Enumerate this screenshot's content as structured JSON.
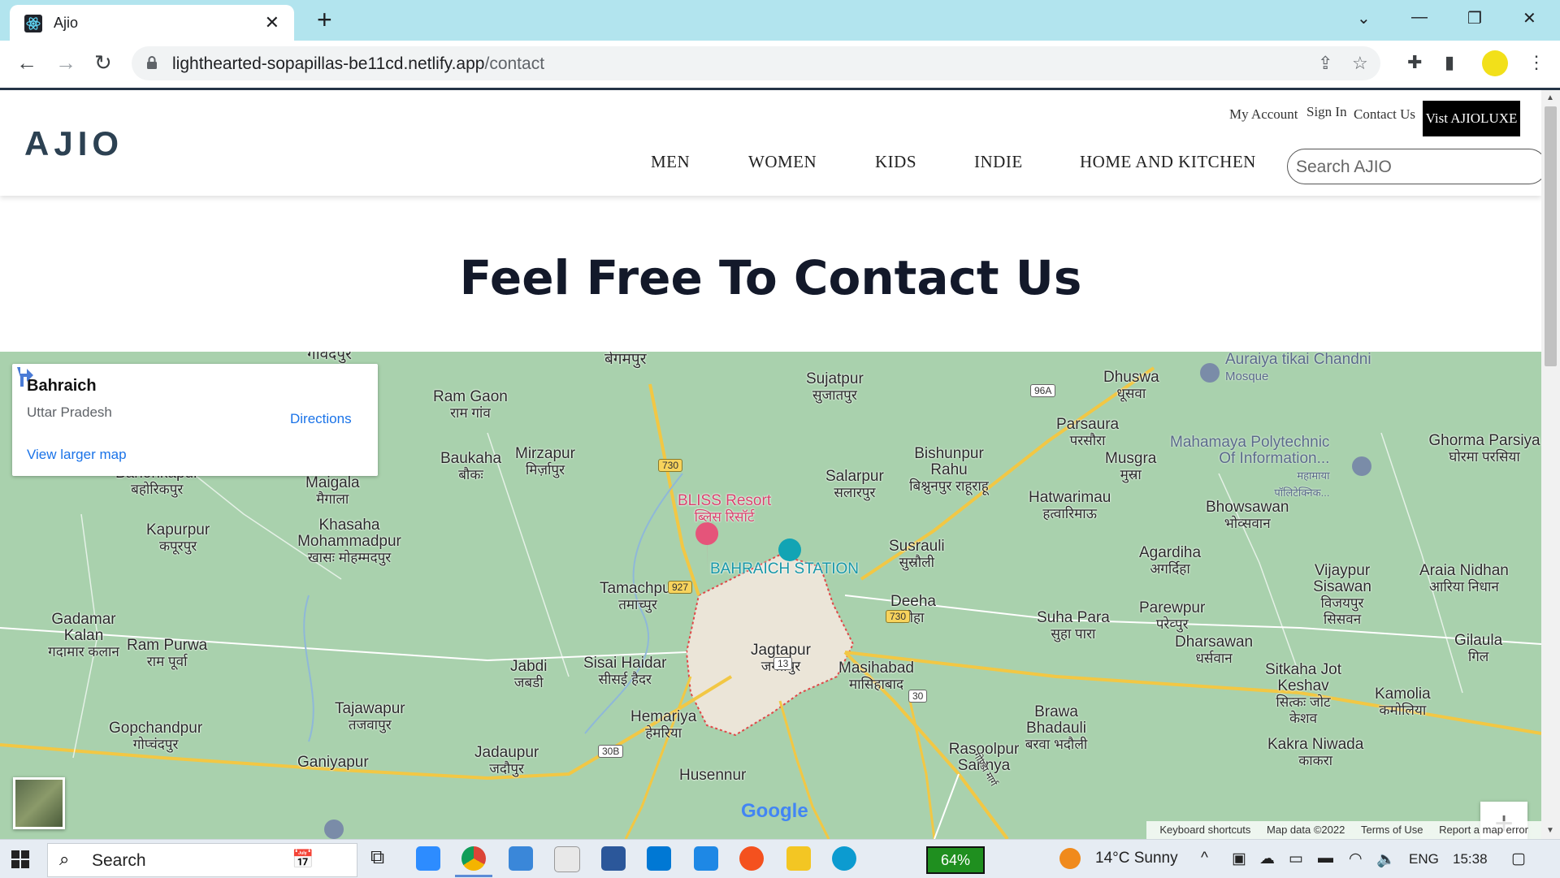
{
  "browser": {
    "tab_title": "Ajio",
    "url_host": "lighthearted-sopapillas-be11cd.netlify.app",
    "url_path": "/contact"
  },
  "site": {
    "logo": "AJIO",
    "top_links": [
      "My Account",
      "Sign In",
      "Contact Us"
    ],
    "luxe_button": "Vist AJIOLUXE",
    "nav": [
      "MEN",
      "WOMEN",
      "KIDS",
      "INDIE",
      "HOME AND KITCHEN"
    ],
    "search_placeholder": "Search AJIO"
  },
  "page": {
    "heading": "Feel Free To Contact Us"
  },
  "map": {
    "info": {
      "title": "Bahraich",
      "subtitle": "Uttar Pradesh",
      "link": "View larger map",
      "directions": "Directions"
    },
    "places": [
      {
        "name": "गांवदपुर",
        "alt": ""
      },
      {
        "name": "बेगमपुर",
        "alt": ""
      },
      {
        "name": "Sujatpur",
        "alt": "सुजातपुर"
      },
      {
        "name": "Ram Gaon",
        "alt": "राम गांव"
      },
      {
        "name": "Dhuswa",
        "alt": "धूसवा"
      },
      {
        "name": "Parsaura",
        "alt": "परसौरा"
      },
      {
        "name": "Musgra",
        "alt": "मुस्रा"
      },
      {
        "name": "Ghorma Parsiya",
        "alt": "घोरमा परसिया"
      },
      {
        "name": "Baukaha",
        "alt": "बौकः"
      },
      {
        "name": "Mirzapur",
        "alt": "मिर्ज़ापुर"
      },
      {
        "name": "Bahorikapur",
        "alt": "बहोरिकपुर"
      },
      {
        "name": "Maigala",
        "alt": "मैगाला"
      },
      {
        "name": "Bishunpur Rahu",
        "alt": "बिश्नुनपुर राहूराहू"
      },
      {
        "name": "Salarpur",
        "alt": "सलारपुर"
      },
      {
        "name": "Hatwarimau",
        "alt": "हत्वारिमाऊ"
      },
      {
        "name": "Bhowsawan",
        "alt": "भोव्सवान"
      },
      {
        "name": "Kapurpur",
        "alt": "कपूरपुर"
      },
      {
        "name": "Khasaha Mohammadpur",
        "alt": "खासः मोहम्मदपुर"
      },
      {
        "name": "Susrauli",
        "alt": "सुस्रौली"
      },
      {
        "name": "Agardiha",
        "alt": "अगर्दिहा"
      },
      {
        "name": "Vijaypur Sisawan",
        "alt": "विजयपुर सिसवन"
      },
      {
        "name": "Araia Nidhan",
        "alt": "आरिया निधान"
      },
      {
        "name": "Tamachpur",
        "alt": "तमाच्पुर"
      },
      {
        "name": "Deeha",
        "alt": "डीहा"
      },
      {
        "name": "Suha Para",
        "alt": "सुहा पारा"
      },
      {
        "name": "Parewpur",
        "alt": "परेव्पुर"
      },
      {
        "name": "Dharsawan",
        "alt": "धर्सवान"
      },
      {
        "name": "Gadamar Kalan",
        "alt": "गदामार कलान"
      },
      {
        "name": "Ram Purwa",
        "alt": "राम पूर्वा"
      },
      {
        "name": "Jabdi",
        "alt": "जबडी"
      },
      {
        "name": "Sisai Haidar",
        "alt": "सीसई हैदर"
      },
      {
        "name": "Jagtapur",
        "alt": "जगतपुर"
      },
      {
        "name": "Masihabad",
        "alt": "मासिहाबाद"
      },
      {
        "name": "Gilaula",
        "alt": "गिल"
      },
      {
        "name": "Sitkaha Jot Keshav",
        "alt": "सित्कः जोट केशव"
      },
      {
        "name": "Kamolia",
        "alt": "कमोलिया"
      },
      {
        "name": "Tajawapur",
        "alt": "तजवापुर"
      },
      {
        "name": "Gopchandpur",
        "alt": "गोप्चंदपुर"
      },
      {
        "name": "Hemariya",
        "alt": "हेमरिया"
      },
      {
        "name": "Brawa Bhadauli",
        "alt": "बरवा भदौली"
      },
      {
        "name": "Kakra Niwada",
        "alt": "काकरा"
      },
      {
        "name": "Ganiyapur",
        "alt": ""
      },
      {
        "name": "Jadaupur",
        "alt": "जदौपुर"
      },
      {
        "name": "Rasoolpur Sarinya",
        "alt": ""
      },
      {
        "name": "Husennur",
        "alt": ""
      }
    ],
    "pois": {
      "bliss": "BLISS Resort",
      "bliss_alt": "ब्लिस रिसॉर्ट",
      "station": "BAHRAICH STATION",
      "mosque": "Auraiya tikai Chandni",
      "mosque_sub": "Mosque",
      "poly": "Mahamaya Polytechnic",
      "poly2": "Of Information...",
      "poly_alt": "महामाया",
      "poly_alt2": "पॉलिटेक्निक..."
    },
    "roads": [
      "730",
      "927",
      "96A",
      "13",
      "30",
      "30B",
      "730"
    ],
    "road_label": "गोण्डा मार्ग",
    "google": "Google",
    "attribution": [
      "Keyboard shortcuts",
      "Map data ©2022",
      "Terms of Use",
      "Report a map error"
    ]
  },
  "taskbar": {
    "search": "Search",
    "battery": "64%",
    "weather": "14°C  Sunny",
    "lang": "ENG",
    "time": "15:38"
  }
}
